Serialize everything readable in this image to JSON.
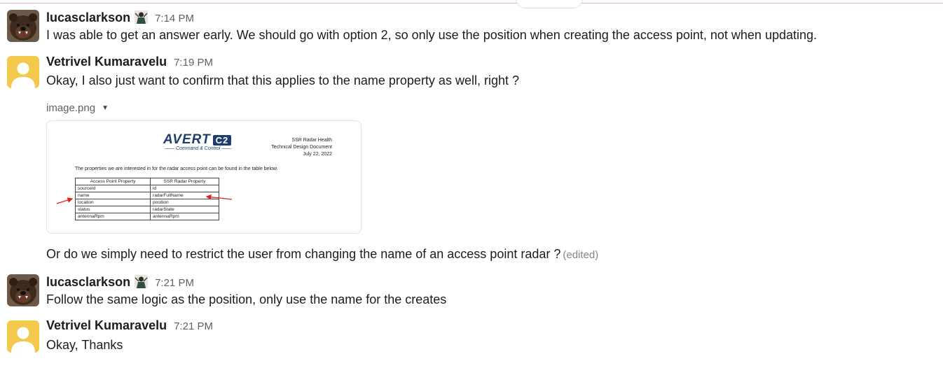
{
  "messages": [
    {
      "author": "lucasclarkson",
      "time": "7:14 PM",
      "text": "I was able to get an answer early. We should go with option 2, so only use the position when creating the access point, not when updating."
    },
    {
      "author": "Vetrivel Kumaravelu",
      "time": "7:19 PM",
      "text": "Okay, I also just want to confirm that this applies to the name property as well, right ?",
      "file": {
        "name": "image.png",
        "logo": "AVERT",
        "logo_badge": "C2",
        "logo_tagline": "Command & Control",
        "doc_title_lines": [
          "SSR Radar Health",
          "Technical Design Document",
          "July 22, 2022"
        ],
        "intro": "The properties we are interested in for the radar access point can be found in the table below.",
        "columns": [
          "Access Point Property",
          "SSR Radar Property"
        ],
        "rows": [
          [
            "sourceId",
            "id"
          ],
          [
            "name",
            "radarFullName"
          ],
          [
            "location",
            "position"
          ],
          [
            "status",
            "radarState"
          ],
          [
            "antennaRpm",
            "antennaRpm"
          ]
        ]
      },
      "followup": "Or do we simply need to restrict the user from changing the name of an access point radar  ?",
      "edited": "(edited)"
    },
    {
      "author": "lucasclarkson",
      "time": "7:21 PM",
      "text": "Follow the same logic as the position, only use the name for the creates"
    },
    {
      "author": "Vetrivel Kumaravelu",
      "time": "7:21 PM",
      "text": "Okay, Thanks"
    }
  ],
  "icons": {
    "bear_avatar": "bear-avatar",
    "default_avatar": "default-user-avatar",
    "status": "status-emoji-icon",
    "caret": "caret-down-icon"
  },
  "colors": {
    "author": "#1d1c1d",
    "timestamp": "#616061",
    "default_avatar_bg": "#f2c94c",
    "doc_brand": "#1f3d6b",
    "annotation_arrow": "#e02020"
  }
}
